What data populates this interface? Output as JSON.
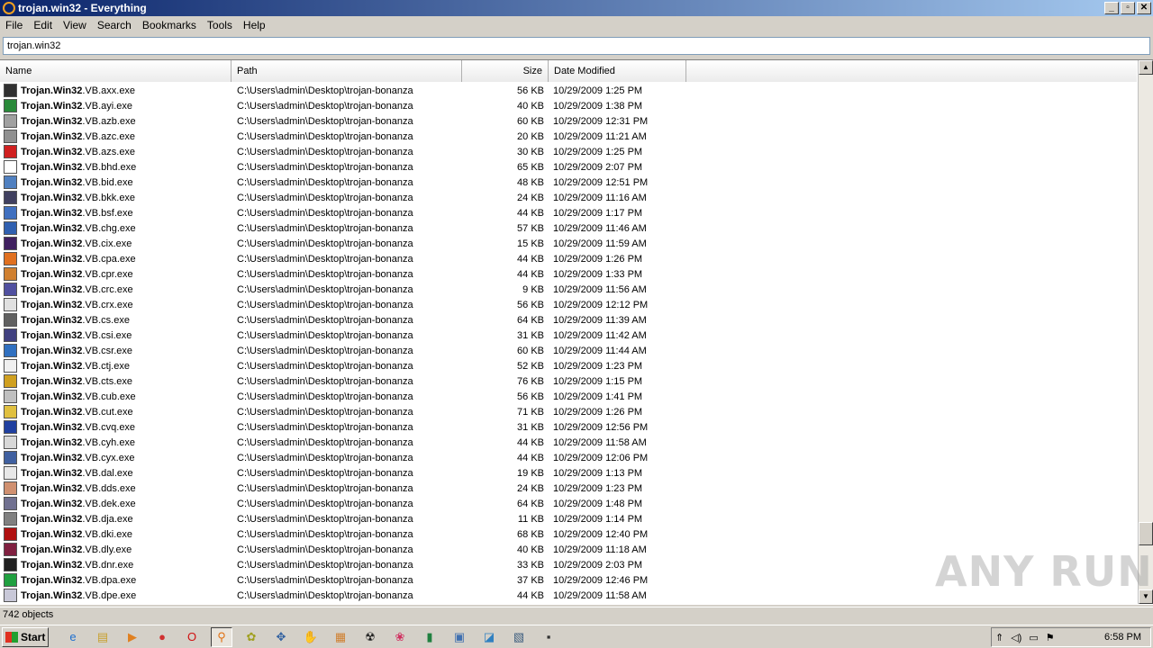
{
  "window": {
    "title": "trojan.win32 - Everything",
    "minimize_label": "_",
    "maximize_label": "▫",
    "close_label": "✕"
  },
  "menu": [
    "File",
    "Edit",
    "View",
    "Search",
    "Bookmarks",
    "Tools",
    "Help"
  ],
  "search": {
    "value": "trojan.win32"
  },
  "columns": {
    "name": "Name",
    "path": "Path",
    "size": "Size",
    "date": "Date Modified"
  },
  "rows": [
    {
      "prefix": "Trojan.Win32",
      "suffix": ".VB.axx.exe",
      "path": "C:\\Users\\admin\\Desktop\\trojan-bonanza",
      "size": "56 KB",
      "date": "10/29/2009 1:25 PM",
      "icon_color": "#303030"
    },
    {
      "prefix": "Trojan.Win32",
      "suffix": ".VB.ayi.exe",
      "path": "C:\\Users\\admin\\Desktop\\trojan-bonanza",
      "size": "40 KB",
      "date": "10/29/2009 1:38 PM",
      "icon_color": "#2a8a3a"
    },
    {
      "prefix": "Trojan.Win32",
      "suffix": ".VB.azb.exe",
      "path": "C:\\Users\\admin\\Desktop\\trojan-bonanza",
      "size": "60 KB",
      "date": "10/29/2009 12:31 PM",
      "icon_color": "#a0a0a0"
    },
    {
      "prefix": "Trojan.Win32",
      "suffix": ".VB.azc.exe",
      "path": "C:\\Users\\admin\\Desktop\\trojan-bonanza",
      "size": "20 KB",
      "date": "10/29/2009 11:21 AM",
      "icon_color": "#909090"
    },
    {
      "prefix": "Trojan.Win32",
      "suffix": ".VB.azs.exe",
      "path": "C:\\Users\\admin\\Desktop\\trojan-bonanza",
      "size": "30 KB",
      "date": "10/29/2009 1:25 PM",
      "icon_color": "#d02020"
    },
    {
      "prefix": "Trojan.Win32",
      "suffix": ".VB.bhd.exe",
      "path": "C:\\Users\\admin\\Desktop\\trojan-bonanza",
      "size": "65 KB",
      "date": "10/29/2009 2:07 PM",
      "icon_color": "#ffffff"
    },
    {
      "prefix": "Trojan.Win32",
      "suffix": ".VB.bid.exe",
      "path": "C:\\Users\\admin\\Desktop\\trojan-bonanza",
      "size": "48 KB",
      "date": "10/29/2009 12:51 PM",
      "icon_color": "#5080c0"
    },
    {
      "prefix": "Trojan.Win32",
      "suffix": ".VB.bkk.exe",
      "path": "C:\\Users\\admin\\Desktop\\trojan-bonanza",
      "size": "24 KB",
      "date": "10/29/2009 11:16 AM",
      "icon_color": "#404060"
    },
    {
      "prefix": "Trojan.Win32",
      "suffix": ".VB.bsf.exe",
      "path": "C:\\Users\\admin\\Desktop\\trojan-bonanza",
      "size": "44 KB",
      "date": "10/29/2009 1:17 PM",
      "icon_color": "#4070c0"
    },
    {
      "prefix": "Trojan.Win32",
      "suffix": ".VB.chg.exe",
      "path": "C:\\Users\\admin\\Desktop\\trojan-bonanza",
      "size": "57 KB",
      "date": "10/29/2009 11:46 AM",
      "icon_color": "#3060b0"
    },
    {
      "prefix": "Trojan.Win32",
      "suffix": ".VB.cix.exe",
      "path": "C:\\Users\\admin\\Desktop\\trojan-bonanza",
      "size": "15 KB",
      "date": "10/29/2009 11:59 AM",
      "icon_color": "#402060"
    },
    {
      "prefix": "Trojan.Win32",
      "suffix": ".VB.cpa.exe",
      "path": "C:\\Users\\admin\\Desktop\\trojan-bonanza",
      "size": "44 KB",
      "date": "10/29/2009 1:26 PM",
      "icon_color": "#e07020"
    },
    {
      "prefix": "Trojan.Win32",
      "suffix": ".VB.cpr.exe",
      "path": "C:\\Users\\admin\\Desktop\\trojan-bonanza",
      "size": "44 KB",
      "date": "10/29/2009 1:33 PM",
      "icon_color": "#d08030"
    },
    {
      "prefix": "Trojan.Win32",
      "suffix": ".VB.crc.exe",
      "path": "C:\\Users\\admin\\Desktop\\trojan-bonanza",
      "size": "9 KB",
      "date": "10/29/2009 11:56 AM",
      "icon_color": "#5050a0"
    },
    {
      "prefix": "Trojan.Win32",
      "suffix": ".VB.crx.exe",
      "path": "C:\\Users\\admin\\Desktop\\trojan-bonanza",
      "size": "56 KB",
      "date": "10/29/2009 12:12 PM",
      "icon_color": "#e0e0e0"
    },
    {
      "prefix": "Trojan.Win32",
      "suffix": ".VB.cs.exe",
      "path": "C:\\Users\\admin\\Desktop\\trojan-bonanza",
      "size": "64 KB",
      "date": "10/29/2009 11:39 AM",
      "icon_color": "#606060"
    },
    {
      "prefix": "Trojan.Win32",
      "suffix": ".VB.csi.exe",
      "path": "C:\\Users\\admin\\Desktop\\trojan-bonanza",
      "size": "31 KB",
      "date": "10/29/2009 11:42 AM",
      "icon_color": "#404080"
    },
    {
      "prefix": "Trojan.Win32",
      "suffix": ".VB.csr.exe",
      "path": "C:\\Users\\admin\\Desktop\\trojan-bonanza",
      "size": "60 KB",
      "date": "10/29/2009 11:44 AM",
      "icon_color": "#3070c0"
    },
    {
      "prefix": "Trojan.Win32",
      "suffix": ".VB.ctj.exe",
      "path": "C:\\Users\\admin\\Desktop\\trojan-bonanza",
      "size": "52 KB",
      "date": "10/29/2009 1:23 PM",
      "icon_color": "#f0f0f0"
    },
    {
      "prefix": "Trojan.Win32",
      "suffix": ".VB.cts.exe",
      "path": "C:\\Users\\admin\\Desktop\\trojan-bonanza",
      "size": "76 KB",
      "date": "10/29/2009 1:15 PM",
      "icon_color": "#d0a020"
    },
    {
      "prefix": "Trojan.Win32",
      "suffix": ".VB.cub.exe",
      "path": "C:\\Users\\admin\\Desktop\\trojan-bonanza",
      "size": "56 KB",
      "date": "10/29/2009 1:41 PM",
      "icon_color": "#c0c0c0"
    },
    {
      "prefix": "Trojan.Win32",
      "suffix": ".VB.cut.exe",
      "path": "C:\\Users\\admin\\Desktop\\trojan-bonanza",
      "size": "71 KB",
      "date": "10/29/2009 1:26 PM",
      "icon_color": "#e0c040"
    },
    {
      "prefix": "Trojan.Win32",
      "suffix": ".VB.cvq.exe",
      "path": "C:\\Users\\admin\\Desktop\\trojan-bonanza",
      "size": "31 KB",
      "date": "10/29/2009 12:56 PM",
      "icon_color": "#2040a0"
    },
    {
      "prefix": "Trojan.Win32",
      "suffix": ".VB.cyh.exe",
      "path": "C:\\Users\\admin\\Desktop\\trojan-bonanza",
      "size": "44 KB",
      "date": "10/29/2009 11:58 AM",
      "icon_color": "#d8d8d8"
    },
    {
      "prefix": "Trojan.Win32",
      "suffix": ".VB.cyx.exe",
      "path": "C:\\Users\\admin\\Desktop\\trojan-bonanza",
      "size": "44 KB",
      "date": "10/29/2009 12:06 PM",
      "icon_color": "#4060a0"
    },
    {
      "prefix": "Trojan.Win32",
      "suffix": ".VB.dal.exe",
      "path": "C:\\Users\\admin\\Desktop\\trojan-bonanza",
      "size": "19 KB",
      "date": "10/29/2009 1:13 PM",
      "icon_color": "#e8e8e8"
    },
    {
      "prefix": "Trojan.Win32",
      "suffix": ".VB.dds.exe",
      "path": "C:\\Users\\admin\\Desktop\\trojan-bonanza",
      "size": "24 KB",
      "date": "10/29/2009 1:23 PM",
      "icon_color": "#d09070"
    },
    {
      "prefix": "Trojan.Win32",
      "suffix": ".VB.dek.exe",
      "path": "C:\\Users\\admin\\Desktop\\trojan-bonanza",
      "size": "64 KB",
      "date": "10/29/2009 1:48 PM",
      "icon_color": "#707090"
    },
    {
      "prefix": "Trojan.Win32",
      "suffix": ".VB.dja.exe",
      "path": "C:\\Users\\admin\\Desktop\\trojan-bonanza",
      "size": "11 KB",
      "date": "10/29/2009 1:14 PM",
      "icon_color": "#808080"
    },
    {
      "prefix": "Trojan.Win32",
      "suffix": ".VB.dki.exe",
      "path": "C:\\Users\\admin\\Desktop\\trojan-bonanza",
      "size": "68 KB",
      "date": "10/29/2009 12:40 PM",
      "icon_color": "#b01010"
    },
    {
      "prefix": "Trojan.Win32",
      "suffix": ".VB.dly.exe",
      "path": "C:\\Users\\admin\\Desktop\\trojan-bonanza",
      "size": "40 KB",
      "date": "10/29/2009 11:18 AM",
      "icon_color": "#802040"
    },
    {
      "prefix": "Trojan.Win32",
      "suffix": ".VB.dnr.exe",
      "path": "C:\\Users\\admin\\Desktop\\trojan-bonanza",
      "size": "33 KB",
      "date": "10/29/2009 2:03 PM",
      "icon_color": "#202020"
    },
    {
      "prefix": "Trojan.Win32",
      "suffix": ".VB.dpa.exe",
      "path": "C:\\Users\\admin\\Desktop\\trojan-bonanza",
      "size": "37 KB",
      "date": "10/29/2009 12:46 PM",
      "icon_color": "#20a040"
    },
    {
      "prefix": "Trojan.Win32",
      "suffix": ".VB.dpe.exe",
      "path": "C:\\Users\\admin\\Desktop\\trojan-bonanza",
      "size": "44 KB",
      "date": "10/29/2009 11:58 AM",
      "icon_color": "#c8c8d8"
    }
  ],
  "status": {
    "text": "742 objects"
  },
  "taskbar": {
    "start_label": "Start",
    "icons": [
      {
        "name": "ie-icon",
        "glyph": "e",
        "color": "#1e6fd0"
      },
      {
        "name": "explorer-icon",
        "glyph": "▤",
        "color": "#c8a030"
      },
      {
        "name": "media-player-icon",
        "glyph": "▶",
        "color": "#e08020"
      },
      {
        "name": "chrome-icon",
        "glyph": "●",
        "color": "#d03030"
      },
      {
        "name": "opera-icon",
        "glyph": "O",
        "color": "#d01010"
      },
      {
        "name": "everything-icon",
        "glyph": "⚲",
        "color": "#e07010",
        "active": true
      },
      {
        "name": "app-icon-1",
        "glyph": "✿",
        "color": "#a0a020"
      },
      {
        "name": "app-icon-2",
        "glyph": "✥",
        "color": "#3060a0"
      },
      {
        "name": "app-icon-3",
        "glyph": "✋",
        "color": "#505050"
      },
      {
        "name": "app-icon-4",
        "glyph": "▦",
        "color": "#d08030"
      },
      {
        "name": "radiation-icon",
        "glyph": "☢",
        "color": "#202020"
      },
      {
        "name": "app-icon-5",
        "glyph": "❀",
        "color": "#d03060"
      },
      {
        "name": "app-icon-6",
        "glyph": "▮",
        "color": "#208040"
      },
      {
        "name": "app-icon-7",
        "glyph": "▣",
        "color": "#4070b0"
      },
      {
        "name": "app-icon-8",
        "glyph": "◪",
        "color": "#3080c0"
      },
      {
        "name": "app-icon-9",
        "glyph": "▧",
        "color": "#406080"
      },
      {
        "name": "save-icon",
        "glyph": "▪",
        "color": "#303030"
      }
    ],
    "clock": "6:58 PM"
  },
  "watermark": "ANY RUN"
}
